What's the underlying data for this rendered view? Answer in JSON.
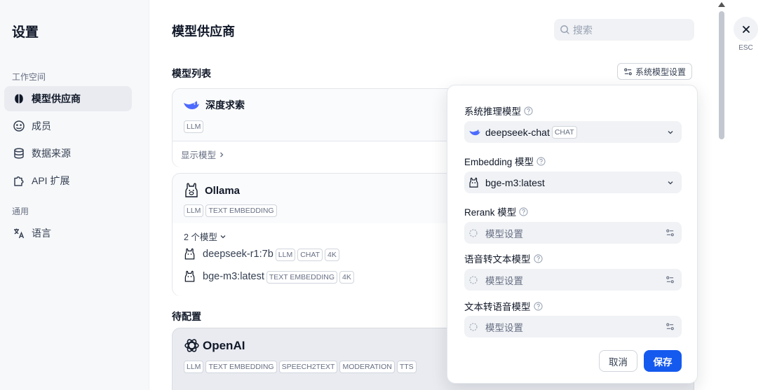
{
  "sidebar": {
    "title": "设置",
    "group_workspace": "工作空间",
    "group_general": "通用",
    "items": [
      {
        "label": "模型供应商",
        "icon": "brain-icon"
      },
      {
        "label": "成员",
        "icon": "members-icon"
      },
      {
        "label": "数据来源",
        "icon": "database-icon"
      },
      {
        "label": "API 扩展",
        "icon": "puzzle-icon"
      },
      {
        "label": "语言",
        "icon": "translate-icon"
      }
    ]
  },
  "main": {
    "title": "模型供应商",
    "search_placeholder": "搜索",
    "model_list_title": "模型列表",
    "system_model_settings_label": "系统模型设置",
    "pending_title": "待配置"
  },
  "providers": {
    "deepseek": {
      "name": "深度求索",
      "tags": [
        "LLM"
      ],
      "show_models": "显示模型"
    },
    "ollama": {
      "name": "Ollama",
      "tags": [
        "LLM",
        "TEXT EMBEDDING"
      ],
      "models_toggle": "2 个模型",
      "models": [
        {
          "name": "deepseek-r1:7b",
          "tags": [
            "LLM",
            "CHAT",
            "4K"
          ]
        },
        {
          "name": "bge-m3:latest",
          "tags": [
            "TEXT EMBEDDING",
            "4K"
          ]
        }
      ]
    },
    "openai": {
      "name": "OpenAI",
      "tags": [
        "LLM",
        "TEXT EMBEDDING",
        "SPEECH2TEXT",
        "MODERATION",
        "TTS"
      ]
    }
  },
  "system_model_panel": {
    "fields": [
      {
        "label": "系统推理模型",
        "value": "deepseek-chat",
        "badge": "CHAT",
        "icon": "deepseek-whale-icon"
      },
      {
        "label": "Embedding 模型",
        "value": "bge-m3:latest",
        "icon": "ollama-llama-icon"
      },
      {
        "label": "Rerank 模型",
        "placeholder": "模型设置"
      },
      {
        "label": "语音转文本模型",
        "placeholder": "模型设置"
      },
      {
        "label": "文本转语音模型",
        "placeholder": "模型设置"
      }
    ],
    "cancel_label": "取消",
    "save_label": "保存"
  },
  "esc": {
    "label": "ESC"
  },
  "colors": {
    "primary": "#155aef",
    "active_nav": "#e9ebf0",
    "deepseek_blue": "#4d6bfe"
  }
}
